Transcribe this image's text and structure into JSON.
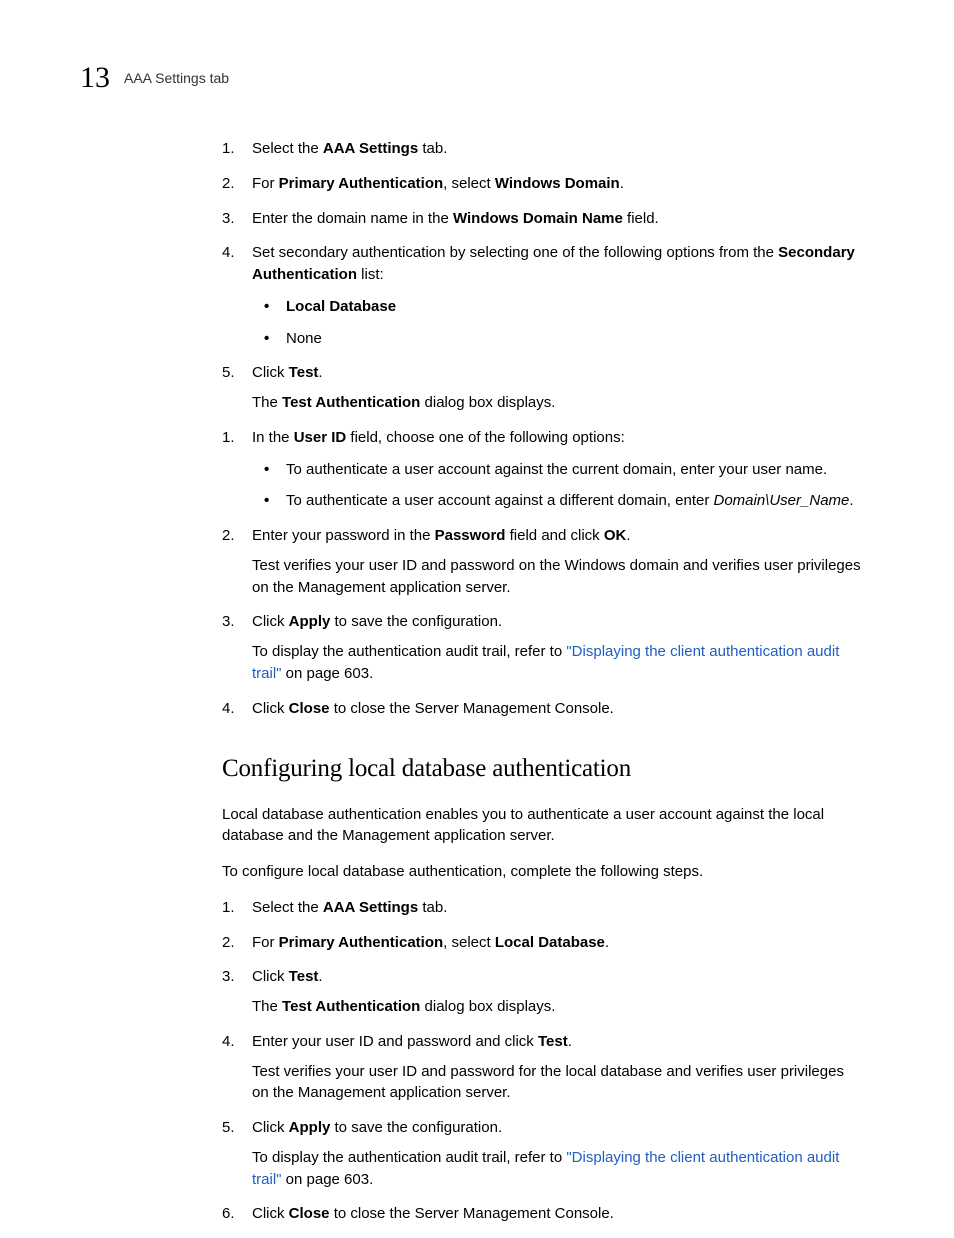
{
  "header": {
    "chapter": "13",
    "title": "AAA Settings tab"
  },
  "section1": {
    "s1_n": "1.",
    "s1_pre": "Select the ",
    "s1_b": "AAA Settings",
    "s1_post": " tab.",
    "s2_n": "2.",
    "s2_pre": "For ",
    "s2_b1": "Primary Authentication",
    "s2_mid": ", select ",
    "s2_b2": "Windows Domain",
    "s2_post": ".",
    "s3_n": "3.",
    "s3_pre": "Enter the domain name in the ",
    "s3_b": "Windows Domain Name",
    "s3_post": " field.",
    "s4_n": "4.",
    "s4_pre": "Set secondary authentication by selecting one of the following options from the ",
    "s4_b": "Secondary Authentication",
    "s4_post": " list:",
    "s4_bul1": "Local Database",
    "s4_bul2": "None",
    "s5_n": "5.",
    "s5_pre": "Click ",
    "s5_b": "Test",
    "s5_post": ".",
    "s5_follow_pre": "The ",
    "s5_follow_b": "Test Authentication",
    "s5_follow_post": " dialog box displays.",
    "t1_n": "1.",
    "t1_pre": "In the ",
    "t1_b": "User ID",
    "t1_post": " field, choose one of the following options:",
    "t1_bul1": "To authenticate a user account against the current domain, enter your user name.",
    "t1_bul2_pre": "To authenticate a user account against a different domain, enter ",
    "t1_bul2_i": "Domain\\User_Name",
    "t1_bul2_post": ".",
    "t2_n": "2.",
    "t2_pre": "Enter your password in the ",
    "t2_b": "Password",
    "t2_mid": " field and click ",
    "t2_b2": "OK",
    "t2_post": ".",
    "t2_follow": "Test verifies your user ID and password on the Windows domain and verifies user privileges on the Management application server.",
    "t3_n": "3.",
    "t3_pre": "Click ",
    "t3_b": "Apply",
    "t3_post": " to save the configuration.",
    "t3_follow_pre": "To display the authentication audit trail, refer to ",
    "t3_link": "\"Displaying the client authentication audit trail\"",
    "t3_follow_post": " on page 603.",
    "t4_n": "4.",
    "t4_pre": "Click ",
    "t4_b": "Close",
    "t4_post": " to close the Server Management Console."
  },
  "section2": {
    "heading": "Configuring local database authentication",
    "intro1": "Local database authentication enables you to authenticate a user account against the local database and the Management application server.",
    "intro2": "To configure local database authentication, complete the following steps.",
    "s1_n": "1.",
    "s1_pre": "Select the ",
    "s1_b": "AAA Settings",
    "s1_post": " tab.",
    "s2_n": "2.",
    "s2_pre": "For ",
    "s2_b1": "Primary Authentication",
    "s2_mid": ", select ",
    "s2_b2": "Local Database",
    "s2_post": ".",
    "s3_n": "3.",
    "s3_pre": "Click ",
    "s3_b": "Test",
    "s3_post": ".",
    "s3_follow_pre": "The ",
    "s3_follow_b": "Test Authentication",
    "s3_follow_post": " dialog box displays.",
    "s4_n": "4.",
    "s4_pre": "Enter your user ID and password and click ",
    "s4_b": "Test",
    "s4_post": ".",
    "s4_follow": "Test verifies your user ID and password for the local database and verifies user privileges on the Management application server.",
    "s5_n": "5.",
    "s5_pre": "Click ",
    "s5_b": "Apply",
    "s5_post": " to save the configuration.",
    "s5_follow_pre": "To display the authentication audit trail, refer to ",
    "s5_link": "\"Displaying the client authentication audit trail\"",
    "s5_follow_post": " on page 603.",
    "s6_n": "6.",
    "s6_pre": "Click ",
    "s6_b": "Close",
    "s6_post": " to close the Server Management Console."
  }
}
